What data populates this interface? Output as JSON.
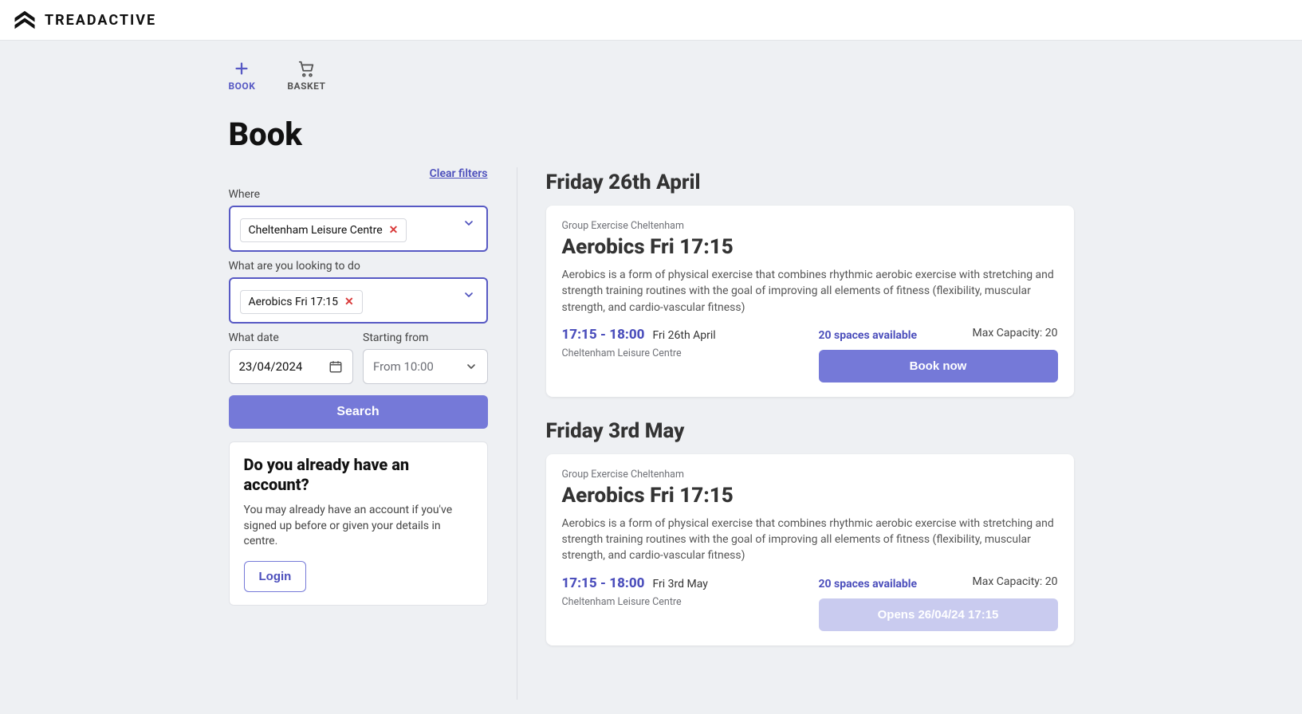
{
  "brand": "TREADACTIVE",
  "tabs": {
    "book": "BOOK",
    "basket": "BASKET"
  },
  "page_title": "Book",
  "filters": {
    "clear_label": "Clear filters",
    "where_label": "Where",
    "where_chip": "Cheltenham Leisure Centre",
    "what_label": "What are you looking to do",
    "what_chip": "Aerobics Fri 17:15",
    "date_label": "What date",
    "date_value": "23/04/2024",
    "starting_label": "Starting from",
    "starting_value": "From 10:00",
    "search_label": "Search"
  },
  "account": {
    "heading": "Do you already have an account?",
    "text": "You may already have an account if you've signed up before or given your details in centre.",
    "login_label": "Login"
  },
  "results": [
    {
      "day_heading": "Friday 26th April",
      "category": "Group Exercise Cheltenham",
      "title": "Aerobics Fri 17:15",
      "description": "Aerobics is a form of physical exercise that combines rhythmic aerobic exercise with stretching and strength training routines with the goal of improving all elements of fitness (flexibility, muscular strength, and cardio-vascular fitness)",
      "time": "17:15 - 18:00",
      "date": "Fri 26th April",
      "location": "Cheltenham Leisure Centre",
      "spaces": "20 spaces available",
      "capacity": "Max Capacity: 20",
      "button_label": "Book now",
      "button_enabled": true
    },
    {
      "day_heading": "Friday 3rd May",
      "category": "Group Exercise Cheltenham",
      "title": "Aerobics Fri 17:15",
      "description": "Aerobics is a form of physical exercise that combines rhythmic aerobic exercise with stretching and strength training routines with the goal of improving all elements of fitness (flexibility, muscular strength, and cardio-vascular fitness)",
      "time": "17:15 - 18:00",
      "date": "Fri 3rd May",
      "location": "Cheltenham Leisure Centre",
      "spaces": "20 spaces available",
      "capacity": "Max Capacity: 20",
      "button_label": "Opens 26/04/24 17:15",
      "button_enabled": false
    }
  ]
}
